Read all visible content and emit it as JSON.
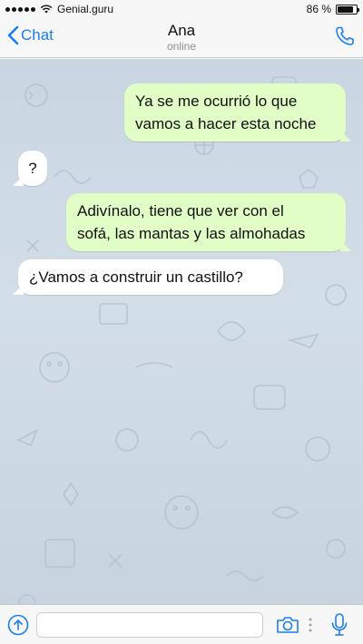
{
  "status_bar": {
    "carrier": "Genial.guru",
    "battery_percent": "86 %",
    "battery_level": 0.86,
    "icons": [
      "signal-icon",
      "wifi-icon",
      "battery-icon"
    ]
  },
  "header": {
    "back_label": "Chat",
    "contact_name": "Ana",
    "contact_status": "online",
    "icons": [
      "chevron-left-icon",
      "phone-icon"
    ],
    "accent_color": "#1a7ef2"
  },
  "messages": [
    {
      "direction": "outgoing",
      "text": "Ya se me ocurrió lo que\nvamos a hacer esta noche"
    },
    {
      "direction": "incoming",
      "text": "?"
    },
    {
      "direction": "outgoing",
      "text": "Adivínalo, tiene que ver con el\nsofá, las mantas y las almohadas"
    },
    {
      "direction": "incoming",
      "text": "¿Vamos a construir un castillo?"
    }
  ],
  "colors": {
    "outgoing_bubble": "#e0fec6",
    "incoming_bubble": "#ffffff",
    "chat_background": "#cdd9e4"
  },
  "input_bar": {
    "placeholder": "",
    "value": "",
    "icons": [
      "attach-icon",
      "camera-icon",
      "more-icon",
      "microphone-icon"
    ]
  }
}
